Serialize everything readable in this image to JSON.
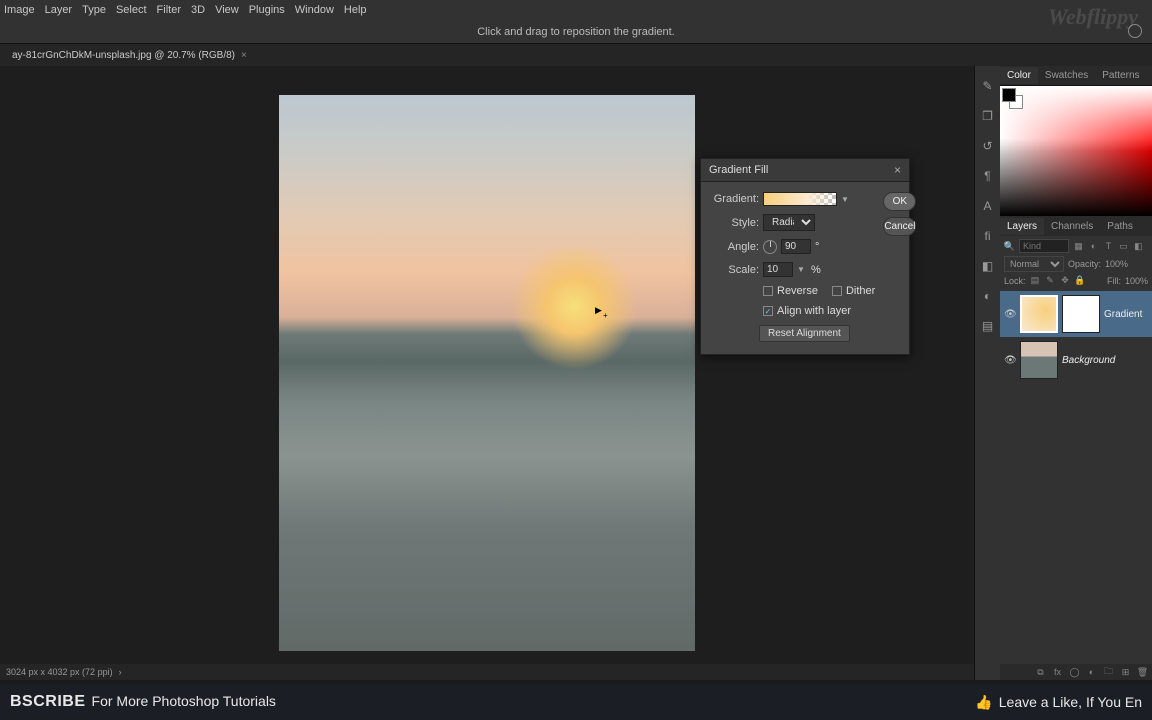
{
  "menu": [
    "Image",
    "Layer",
    "Type",
    "Select",
    "Filter",
    "3D",
    "View",
    "Plugins",
    "Window",
    "Help"
  ],
  "options_hint": "Click and drag to reposition the gradient.",
  "tab": {
    "name": "ay-81crGnChDkM-unsplash.jpg @ 20.7% (RGB/8)"
  },
  "dialog": {
    "title": "Gradient Fill",
    "gradient_label": "Gradient:",
    "style_label": "Style:",
    "style_value": "Radial",
    "angle_label": "Angle:",
    "angle_value": "90",
    "angle_unit": "°",
    "scale_label": "Scale:",
    "scale_value": "10",
    "scale_unit": "%",
    "reverse": "Reverse",
    "dither": "Dither",
    "align": "Align with layer",
    "reset": "Reset Alignment",
    "ok": "OK",
    "cancel": "Cancel"
  },
  "panels": {
    "color_tabs": [
      "Color",
      "Swatches",
      "Patterns"
    ],
    "layer_tabs": [
      "Layers",
      "Channels",
      "Paths"
    ],
    "kind_placeholder": "Kind",
    "blend_mode": "Normal",
    "opacity_label": "Opacity:",
    "opacity_value": "100%",
    "lock_label": "Lock:",
    "fill_label": "Fill:",
    "fill_value": "100%",
    "layers": [
      {
        "name": "Gradient",
        "italic": false
      },
      {
        "name": "Background",
        "italic": true
      }
    ]
  },
  "status": {
    "dims": "3024 px x 4032 px (72 ppi)",
    "arrow": "›"
  },
  "banner": {
    "subscribe_big": "BSCRIBE",
    "subscribe_rest": "For More Photoshop Tutorials",
    "like": "Leave a Like, If You En"
  },
  "watermark": "Webflippy"
}
